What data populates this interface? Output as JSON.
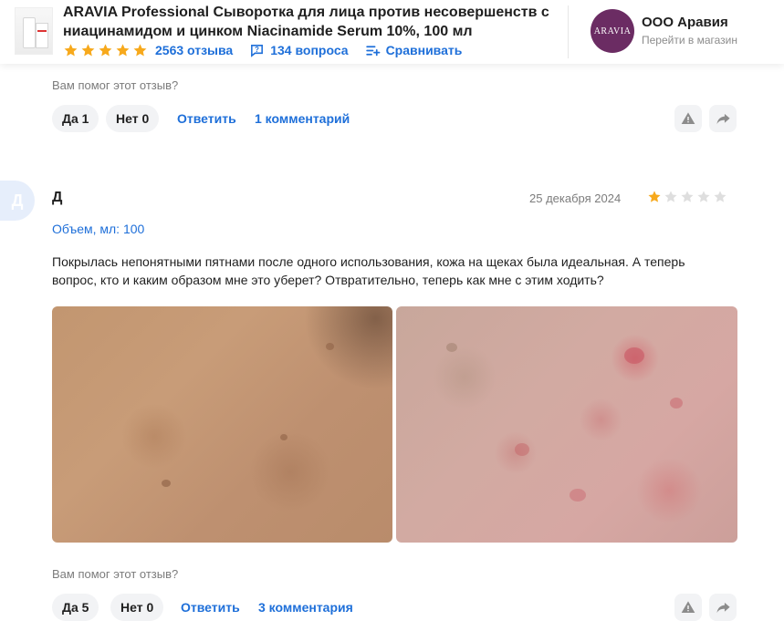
{
  "header": {
    "product_title": "ARAVIA Professional Сыворотка для лица против несовершенств с ниацинамидом и цинком Niacinamide Serum 10%, 100 мл",
    "rating": 5,
    "reviews_count": "2563 отзыва",
    "questions_count": "134 вопроса",
    "compare_label": "Сравнивать",
    "shop": {
      "logo_text": "ARAVIA",
      "name": "ООО Аравия",
      "link_label": "Перейти в магазин"
    },
    "colors": {
      "accent": "#1e6fd9",
      "star": "#f7a91c",
      "brand": "#6b2c63"
    }
  },
  "review_prev": {
    "helpful_prompt": "Вам помог этот отзыв?",
    "yes_label": "Да 1",
    "no_label": "Нет 0",
    "reply_label": "Ответить",
    "comments_label": "1 комментарий"
  },
  "review": {
    "avatar_letter": "Д",
    "author": "Д",
    "date": "25 декабря 2024",
    "rating": 1,
    "rating_max": 5,
    "variant": "Объем, мл: 100",
    "text": "Покрылась непонятными пятнами после одного использования, кожа на щеках была идеальная. А теперь вопрос, кто и каким образом мне это уберет? Отвратительно, теперь как мне с этим ходить?",
    "photos": [
      "skin-photo-before",
      "skin-photo-after"
    ],
    "helpful_prompt": "Вам помог этот отзыв?",
    "yes_label": "Да 5",
    "no_label": "Нет 0",
    "reply_label": "Ответить",
    "comments_label": "3 комментария"
  },
  "icons": {
    "report": "warning-icon",
    "share": "share-icon"
  }
}
